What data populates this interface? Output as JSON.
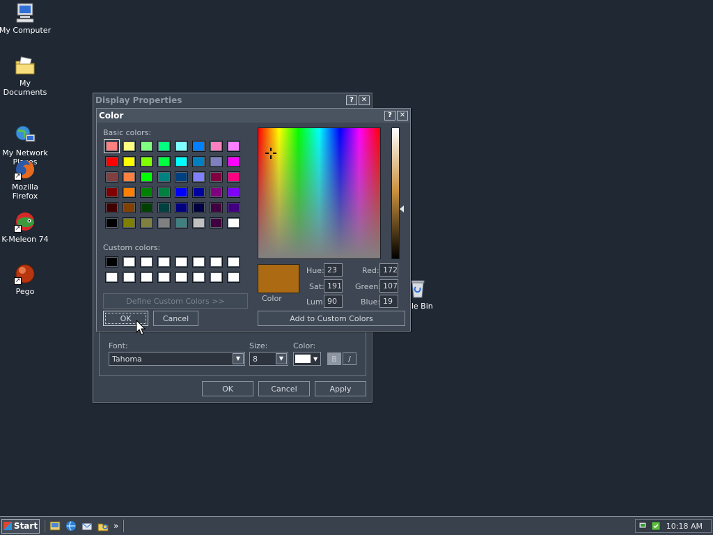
{
  "desktop": {
    "icons": [
      {
        "label": "My Computer",
        "icon": "computer-icon"
      },
      {
        "label": "My Documents",
        "icon": "documents-folder-icon"
      },
      {
        "label": "My Network\nPlaces",
        "icon": "network-places-icon"
      },
      {
        "label": "Mozilla Firefox",
        "icon": "firefox-icon"
      },
      {
        "label": "K-Meleon 74",
        "icon": "k-meleon-icon"
      },
      {
        "label": "Pego",
        "icon": "pego-icon"
      },
      {
        "label": "ycle Bin",
        "icon": "recycle-bin-icon"
      }
    ]
  },
  "display_properties": {
    "title": "Display Properties",
    "help_btn": "?",
    "close_btn": "✕",
    "font_label": "Font:",
    "font_value": "Tahoma",
    "size_label": "Size:",
    "size_value": "8",
    "color_label": "Color:",
    "bold_btn": "B",
    "italic_btn": "/",
    "ok": "OK",
    "cancel": "Cancel",
    "apply": "Apply"
  },
  "color_dialog": {
    "title": "Color",
    "help_btn": "?",
    "close_btn": "✕",
    "basic_colors_label": "Basic colors:",
    "custom_colors_label": "Custom colors:",
    "define_custom": "Define Custom Colors >>",
    "ok": "OK",
    "cancel": "Cancel",
    "color_label": "Color",
    "hue_label": "Hue:",
    "hue": "23",
    "sat_label": "Sat:",
    "sat": "191",
    "lum_label": "Lum:",
    "lum": "90",
    "red_label": "Red:",
    "red": "172",
    "green_label": "Green:",
    "green": "107",
    "blue_label": "Blue:",
    "blue": "19",
    "add_custom": "Add to Custom Colors",
    "current_color": "#ac6b13",
    "basic_colors": [
      "#ff8080",
      "#ffff80",
      "#80ff80",
      "#00ff80",
      "#80ffff",
      "#0080ff",
      "#ff80c0",
      "#ff80ff",
      "#ff0000",
      "#ffff00",
      "#80ff00",
      "#00ff40",
      "#00ffff",
      "#0080c0",
      "#8080c0",
      "#ff00ff",
      "#804040",
      "#ff8040",
      "#00ff00",
      "#008080",
      "#004080",
      "#8080ff",
      "#800040",
      "#ff0080",
      "#800000",
      "#ff8000",
      "#008000",
      "#008040",
      "#0000ff",
      "#0000a0",
      "#800080",
      "#8000ff",
      "#400000",
      "#804000",
      "#004000",
      "#004040",
      "#000080",
      "#000040",
      "#400040",
      "#400080",
      "#000000",
      "#808000",
      "#808040",
      "#808080",
      "#408080",
      "#c0c0c0",
      "#400040",
      "#ffffff"
    ],
    "custom_colors": [
      "#000000",
      "#ffffff",
      "#ffffff",
      "#ffffff",
      "#ffffff",
      "#ffffff",
      "#ffffff",
      "#ffffff",
      "#ffffff",
      "#ffffff",
      "#ffffff",
      "#ffffff",
      "#ffffff",
      "#ffffff",
      "#ffffff",
      "#ffffff"
    ]
  },
  "taskbar": {
    "start_label": "Start",
    "clock": "10:18 AM",
    "overflow": "»"
  }
}
